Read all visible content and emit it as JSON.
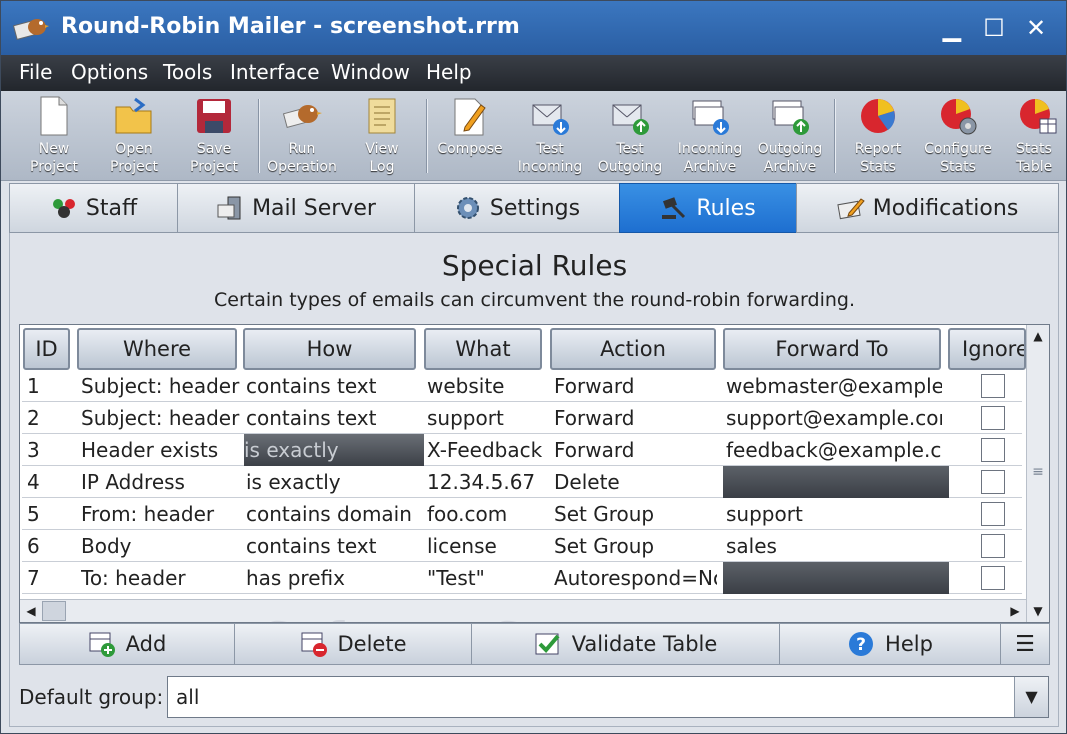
{
  "window": {
    "title": "Round-Robin Mailer - screenshot.rrm",
    "controls": {
      "minimize": "▁",
      "maximize": "☐",
      "close": "✕"
    }
  },
  "menu": [
    "File",
    "Options",
    "Tools",
    "Interface",
    "Window",
    "Help"
  ],
  "toolbar": [
    {
      "label": "New\nProject",
      "icon": "new-project-icon"
    },
    {
      "label": "Open\nProject",
      "icon": "open-project-icon"
    },
    {
      "label": "Save\nProject",
      "icon": "save-project-icon"
    },
    {
      "label": "Run\nOperation",
      "icon": "run-operation-icon"
    },
    {
      "label": "View\nLog",
      "icon": "view-log-icon"
    },
    {
      "label": "Compose",
      "icon": "compose-icon"
    },
    {
      "label": "Test\nIncoming",
      "icon": "test-incoming-icon"
    },
    {
      "label": "Test\nOutgoing",
      "icon": "test-outgoing-icon"
    },
    {
      "label": "Incoming\nArchive",
      "icon": "incoming-archive-icon"
    },
    {
      "label": "Outgoing\nArchive",
      "icon": "outgoing-archive-icon"
    },
    {
      "label": "Report\nStats",
      "icon": "report-stats-icon"
    },
    {
      "label": "Configure\nStats",
      "icon": "configure-stats-icon"
    },
    {
      "label": "Stats\nTable",
      "icon": "stats-table-icon"
    }
  ],
  "tabs": [
    {
      "label": "Staff",
      "active": false
    },
    {
      "label": "Mail Server",
      "active": false
    },
    {
      "label": "Settings",
      "active": false
    },
    {
      "label": "Rules",
      "active": true
    },
    {
      "label": "Modifications",
      "active": false
    }
  ],
  "page": {
    "heading": "Special Rules",
    "subheading": "Certain types of emails can circumvent the round-robin forwarding."
  },
  "table": {
    "columns": [
      "ID",
      "Where",
      "How",
      "What",
      "Action",
      "Forward To",
      "Ignore"
    ],
    "rows": [
      {
        "id": "1",
        "where": "Subject: header",
        "how": "contains text",
        "what": "website",
        "action": "Forward",
        "forward_to": "webmaster@example.c",
        "ignore": false
      },
      {
        "id": "2",
        "where": "Subject: header",
        "how": "contains text",
        "what": "support",
        "action": "Forward",
        "forward_to": "support@example.con",
        "ignore": false
      },
      {
        "id": "3",
        "where": "Header exists",
        "how": "is exactly",
        "what": "X-Feedback",
        "action": "Forward",
        "forward_to": "feedback@example.co",
        "ignore": false
      },
      {
        "id": "4",
        "where": "IP Address",
        "how": "is exactly",
        "what": "12.34.5.67",
        "action": "Delete",
        "forward_to": "",
        "ignore": false
      },
      {
        "id": "5",
        "where": "From: header",
        "how": "contains domain",
        "what": "foo.com",
        "action": "Set Group",
        "forward_to": "support",
        "ignore": false
      },
      {
        "id": "6",
        "where": "Body",
        "how": "contains text",
        "what": "license",
        "action": "Set Group",
        "forward_to": "sales",
        "ignore": false
      },
      {
        "id": "7",
        "where": "To: header",
        "how": "has prefix",
        "what": "\"Test\"",
        "action": "Autorespond=No",
        "forward_to": "",
        "ignore": false
      }
    ]
  },
  "buttons": {
    "add": "Add",
    "delete": "Delete",
    "validate": "Validate Table",
    "help": "Help",
    "menu": "☰"
  },
  "default_group": {
    "label": "Default group:",
    "value": "all"
  },
  "watermark": "SoftwareSuggest.com",
  "colors": {
    "accent": "#1e6fd0",
    "titlebar": "#2a5ea3",
    "menubar": "#2a2e34"
  }
}
